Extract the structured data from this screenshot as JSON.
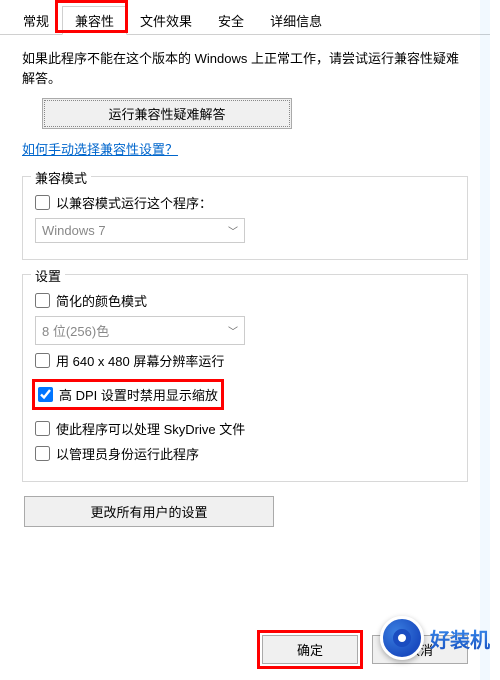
{
  "tabs": {
    "general": "常规",
    "compatibility": "兼容性",
    "file_effects": "文件效果",
    "security": "安全",
    "details": "详细信息"
  },
  "intro": "如果此程序不能在这个版本的 Windows 上正常工作，请尝试运行兼容性疑难解答。",
  "troubleshoot_button": "运行兼容性疑难解答",
  "manual_link": "如何手动选择兼容性设置？",
  "compat_mode": {
    "title": "兼容模式",
    "checkbox": "以兼容模式运行这个程序：",
    "select": "Windows 7"
  },
  "settings": {
    "title": "设置",
    "reduced_color": "简化的颜色模式",
    "color_select": "8 位(256)色",
    "resolution": "用 640 x 480 屏幕分辨率运行",
    "high_dpi": "高 DPI 设置时禁用显示缩放",
    "skydrive": "使此程序可以处理 SkyDrive 文件",
    "admin": "以管理员身份运行此程序"
  },
  "all_users_button": "更改所有用户的设置",
  "footer": {
    "ok": "确定",
    "cancel": "取消"
  },
  "watermark": "好装机"
}
